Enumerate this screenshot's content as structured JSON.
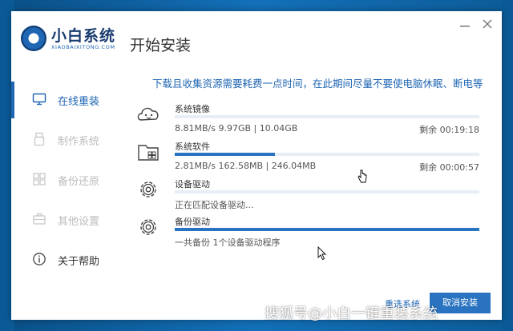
{
  "app": {
    "logo_name": "小白系统",
    "logo_sub": "XIAOBAIXITONG.COM",
    "page_title": "开始安装"
  },
  "sidebar": {
    "items": [
      {
        "label": "在线重装",
        "icon": "monitor-icon",
        "state": "active"
      },
      {
        "label": "制作系统",
        "icon": "usb-icon",
        "state": "disabled"
      },
      {
        "label": "备份还原",
        "icon": "grid-icon",
        "state": "disabled"
      },
      {
        "label": "其他设置",
        "icon": "briefcase-icon",
        "state": "disabled"
      },
      {
        "label": "关于帮助",
        "icon": "info-icon",
        "state": "normal"
      }
    ]
  },
  "content": {
    "notice": "下载且收集资源需要耗费一点时间，在此期间尽量不要使电脑休眠、断电等",
    "tasks": [
      {
        "name": "系统镜像",
        "info": "8.81MB/s 9.97GB | 10.04GB",
        "remain": "剩余 00:19:18",
        "progress": 0.0,
        "icon": "cloud-face-icon"
      },
      {
        "name": "系统软件",
        "info": "2.81MB/s 162.58MB | 246.04MB",
        "remain": "剩余 00:00:57",
        "progress": 0.33,
        "icon": "folder-icon"
      },
      {
        "name": "设备驱动",
        "info": "正在匹配设备驱动...",
        "remain": "",
        "progress": 0.0,
        "icon": "gear-icon"
      },
      {
        "name": "备份驱动",
        "info": "一共备份 1个设备驱动程序",
        "remain": "",
        "progress": 1.0,
        "icon": "gear-icon"
      }
    ]
  },
  "buttons": {
    "reselect": "重选系统",
    "cancel": "取消安装"
  },
  "watermark": "搜狐号@小白一键重装系统",
  "colors": {
    "accent": "#1f66b3",
    "progress": "#2a73c0",
    "track": "#e8eef5",
    "disabled": "#bdbdbd"
  }
}
